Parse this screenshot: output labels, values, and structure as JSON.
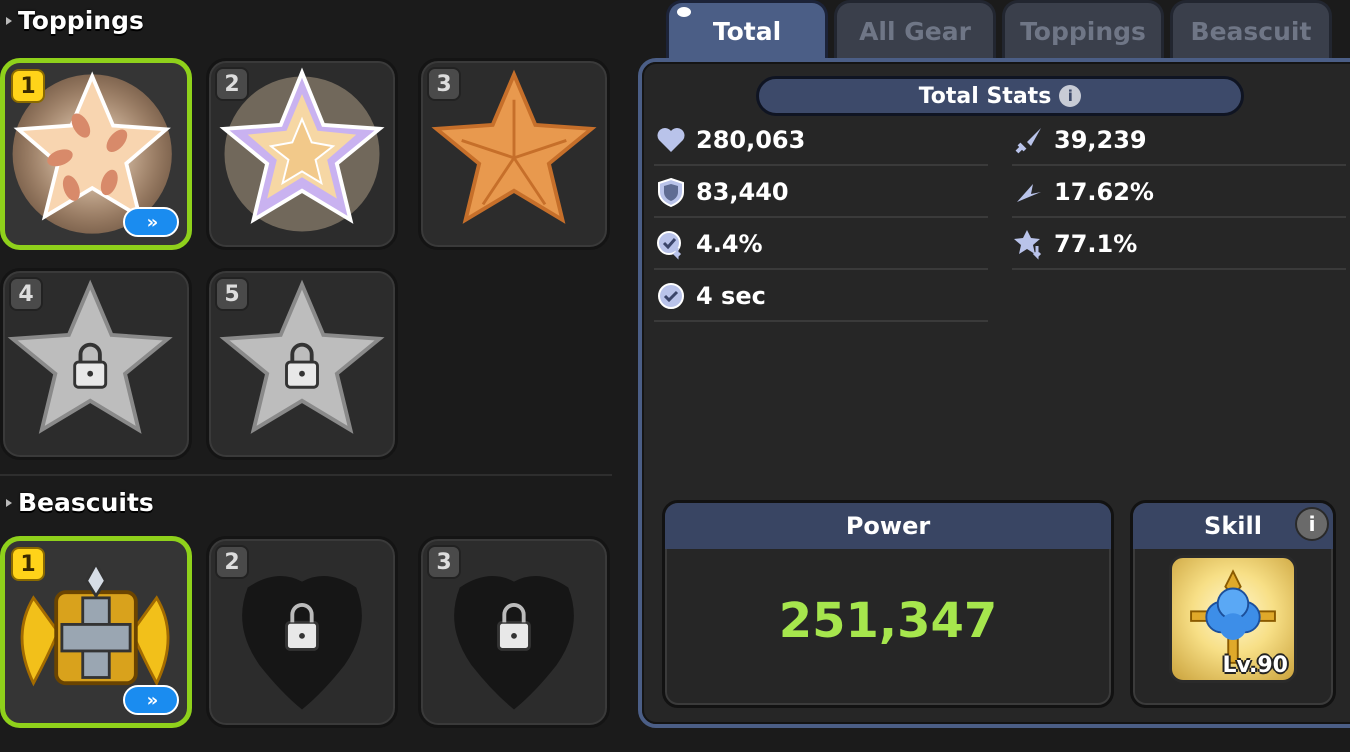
{
  "sections": {
    "toppings_title": "Toppings",
    "beascuits_title": "Beascuits"
  },
  "toppings": [
    {
      "slot": "1",
      "state": "equipped",
      "upgradable": true
    },
    {
      "slot": "2",
      "state": "equipped",
      "upgradable": false
    },
    {
      "slot": "3",
      "state": "equipped",
      "upgradable": false
    },
    {
      "slot": "4",
      "state": "locked",
      "upgradable": false
    },
    {
      "slot": "5",
      "state": "locked",
      "upgradable": false
    }
  ],
  "beascuits": [
    {
      "slot": "1",
      "state": "equipped",
      "upgradable": true
    },
    {
      "slot": "2",
      "state": "locked"
    },
    {
      "slot": "3",
      "state": "locked"
    }
  ],
  "tabs": [
    {
      "label": "Total",
      "active": true
    },
    {
      "label": "All Gear",
      "active": false
    },
    {
      "label": "Toppings",
      "active": false
    },
    {
      "label": "Beascuit",
      "active": false
    }
  ],
  "total_stats": {
    "header": "Total Stats",
    "left": [
      {
        "icon": "heart-icon",
        "value": "280,063"
      },
      {
        "icon": "shield-icon",
        "value": "83,440"
      },
      {
        "icon": "cooldown-icon",
        "value": "4.4%"
      },
      {
        "icon": "clock-icon",
        "value": "4 sec"
      }
    ],
    "right": [
      {
        "icon": "sword-icon",
        "value": "39,239"
      },
      {
        "icon": "crit-icon",
        "value": "17.62%"
      },
      {
        "icon": "debuff-resist-icon",
        "value": "77.1%"
      }
    ]
  },
  "power": {
    "label": "Power",
    "value": "251,347"
  },
  "skill": {
    "label": "Skill",
    "level": "Lv.90"
  },
  "colors": {
    "selected": "#8fd11b",
    "tab_active": "#4b5e86",
    "power": "#a6e64d",
    "badge": "#ffd319"
  }
}
